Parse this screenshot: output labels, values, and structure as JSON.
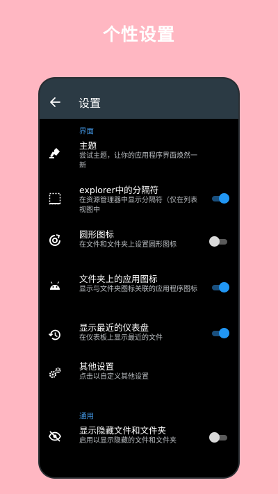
{
  "banner": {
    "title": "个性设置"
  },
  "appbar": {
    "title": "设置"
  },
  "sections": {
    "interface": "界面",
    "general": "通用"
  },
  "items": [
    {
      "title": "主题",
      "subtitle": "尝试主题，让你的应用程序界面焕然一新",
      "icon": "theme-icon"
    },
    {
      "title": "explorer中的分隔符",
      "subtitle": "在资源管理器中显示分隔符（仅在列表视图中",
      "icon": "divider-icon",
      "toggle": true
    },
    {
      "title": "圆形图标",
      "subtitle": "在文件和文件夹上设置圆形图标",
      "icon": "circle-icon",
      "toggle": false
    },
    {
      "title": "文件夹上的应用图标",
      "subtitle": "显示与文件夹图标关联的应用程序图标",
      "icon": "android-icon",
      "toggle": true
    },
    {
      "title": "显示最近的仪表盘",
      "subtitle": "在仪表板上显示最近的文件",
      "icon": "history-icon",
      "toggle": true
    },
    {
      "title": "其他设置",
      "subtitle": "点击以自定义其他设置",
      "icon": "gears-icon"
    },
    {
      "title": "显示隐藏文件和文件夹",
      "subtitle": "启用以显示隐藏的文件和文件夹",
      "icon": "eye-off-icon",
      "toggle": false
    }
  ],
  "colors": {
    "background": "#ffb7c2",
    "appbar": "#2b3a44",
    "accent": "#2196f3",
    "section_header": "#3f8fd8"
  }
}
